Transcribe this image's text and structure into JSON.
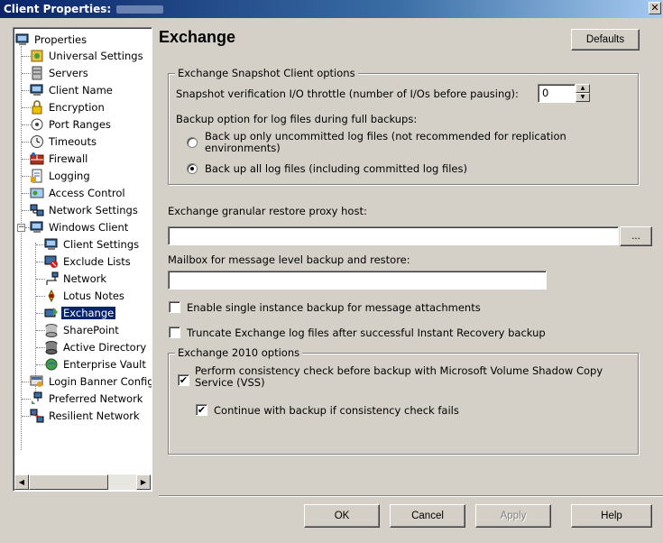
{
  "window": {
    "title": "Client Properties:",
    "close_glyph": "✕"
  },
  "tree": {
    "items": [
      {
        "label": "Properties",
        "icon": "computer-icon"
      },
      {
        "label": "Universal Settings",
        "icon": "universal-settings-icon"
      },
      {
        "label": "Servers",
        "icon": "servers-icon"
      },
      {
        "label": "Client Name",
        "icon": "client-name-icon"
      },
      {
        "label": "Encryption",
        "icon": "lock-icon"
      },
      {
        "label": "Port Ranges",
        "icon": "port-ranges-icon"
      },
      {
        "label": "Timeouts",
        "icon": "clock-icon"
      },
      {
        "label": "Firewall",
        "icon": "firewall-icon"
      },
      {
        "label": "Logging",
        "icon": "logging-icon"
      },
      {
        "label": "Access Control",
        "icon": "access-control-icon"
      },
      {
        "label": "Network Settings",
        "icon": "network-settings-icon"
      },
      {
        "label": "Windows Client",
        "icon": "computer-icon"
      },
      {
        "label": "Client Settings",
        "icon": "computer-icon"
      },
      {
        "label": "Exclude Lists",
        "icon": "exclude-lists-icon"
      },
      {
        "label": "Network",
        "icon": "network-icon"
      },
      {
        "label": "Lotus Notes",
        "icon": "lotus-notes-icon"
      },
      {
        "label": "Exchange",
        "icon": "exchange-icon"
      },
      {
        "label": "SharePoint",
        "icon": "sharepoint-icon"
      },
      {
        "label": "Active Directory",
        "icon": "active-directory-icon"
      },
      {
        "label": "Enterprise Vault",
        "icon": "enterprise-vault-icon"
      },
      {
        "label": "Login Banner Configuration",
        "icon": "login-banner-icon"
      },
      {
        "label": "Preferred Network",
        "icon": "preferred-network-icon"
      },
      {
        "label": "Resilient Network",
        "icon": "resilient-network-icon"
      }
    ],
    "selected": "Exchange"
  },
  "panel": {
    "heading": "Exchange",
    "defaults_button": "Defaults",
    "snapshot_group": {
      "title": "Exchange Snapshot Client options",
      "throttle_label": "Snapshot verification I/O throttle (number of I/Os before pausing):",
      "throttle_value": "0",
      "backup_option_label": "Backup option for log files during full backups:",
      "radio_uncommitted": "Back up only uncommitted log files (not recommended for replication environments)",
      "radio_all": "Back up all log files (including committed log files)",
      "selected_radio": "all"
    },
    "proxy_label": "Exchange granular restore proxy host:",
    "proxy_value": "",
    "browse_button": "...",
    "mailbox_label": "Mailbox for message level backup and restore:",
    "mailbox_value": "",
    "single_instance_label": "Enable single instance backup for message attachments",
    "single_instance_checked": false,
    "truncate_label": "Truncate Exchange log files after successful Instant Recovery backup",
    "truncate_checked": false,
    "exchange2010_group": {
      "title": "Exchange 2010 options",
      "consistency_label": "Perform consistency check before backup with Microsoft Volume Shadow Copy Service (VSS)",
      "consistency_checked": true,
      "continue_label": "Continue with backup if consistency check fails",
      "continue_checked": true
    }
  },
  "footer": {
    "ok": "OK",
    "cancel": "Cancel",
    "apply": "Apply",
    "help": "Help"
  },
  "colors": {
    "selection": "#0a246a",
    "dialog_bg": "#d4d0c8"
  }
}
